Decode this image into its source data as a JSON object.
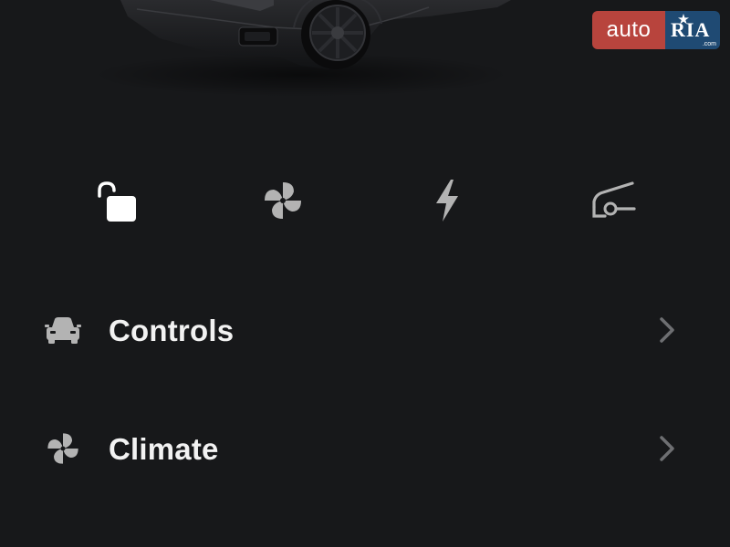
{
  "watermark": {
    "auto": "auto",
    "ria": "RIA",
    "com": ".com"
  },
  "quick_actions": [
    {
      "icon": "unlock-icon",
      "color": "#ffffff"
    },
    {
      "icon": "fan-icon",
      "color": "#b3b3b3"
    },
    {
      "icon": "lightning-bolt-icon",
      "color": "#b3b3b3"
    },
    {
      "icon": "frunk-open-icon",
      "color": "#b3b3b3"
    }
  ],
  "menu": {
    "controls": {
      "label": "Controls",
      "icon": "car-icon"
    },
    "climate": {
      "label": "Climate",
      "icon": "fan-icon"
    }
  },
  "colors": {
    "background": "#17181a",
    "icon_muted": "#b3b3b3",
    "icon_active": "#ffffff",
    "chevron": "#6e6f72",
    "watermark_red": "#b8443d",
    "watermark_blue": "#1f4a73"
  }
}
